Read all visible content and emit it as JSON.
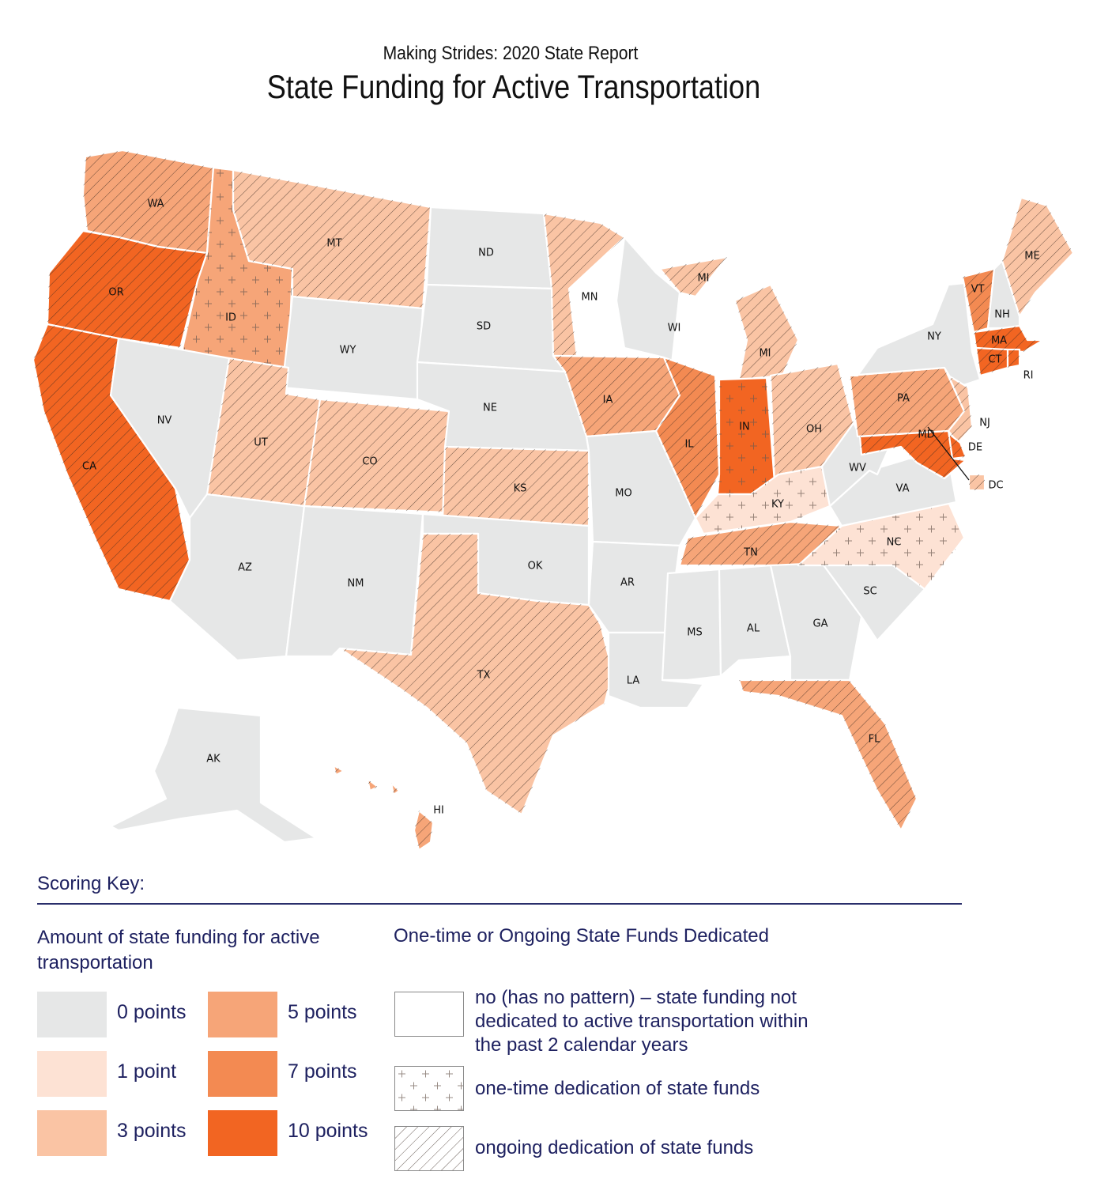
{
  "header": {
    "subtitle": "Making Strides:  2020 State Report",
    "title": "State Funding for Active Transportation"
  },
  "colors": {
    "score_0": "#E6E7E7",
    "score_1": "#FDE2D4",
    "score_3": "#FAC4A4",
    "score_5": "#F6A578",
    "score_7": "#F38A52",
    "score_10": "#F26522",
    "text_navy": "#1E2160",
    "border": "#FFFFFF"
  },
  "chart_data": {
    "type": "choropleth",
    "title": "State Funding for Active Transportation",
    "subtitle": "Making Strides:  2020 State Report",
    "states": [
      {
        "code": "WA",
        "score": 5,
        "pattern": "ongoing"
      },
      {
        "code": "OR",
        "score": 10,
        "pattern": "ongoing"
      },
      {
        "code": "CA",
        "score": 10,
        "pattern": "ongoing"
      },
      {
        "code": "ID",
        "score": 5,
        "pattern": "one-time"
      },
      {
        "code": "NV",
        "score": 0,
        "pattern": "none"
      },
      {
        "code": "MT",
        "score": 3,
        "pattern": "ongoing"
      },
      {
        "code": "WY",
        "score": 0,
        "pattern": "none"
      },
      {
        "code": "UT",
        "score": 3,
        "pattern": "ongoing"
      },
      {
        "code": "AZ",
        "score": 0,
        "pattern": "none"
      },
      {
        "code": "CO",
        "score": 3,
        "pattern": "ongoing"
      },
      {
        "code": "NM",
        "score": 0,
        "pattern": "none"
      },
      {
        "code": "ND",
        "score": 0,
        "pattern": "none"
      },
      {
        "code": "SD",
        "score": 0,
        "pattern": "none"
      },
      {
        "code": "NE",
        "score": 0,
        "pattern": "none"
      },
      {
        "code": "KS",
        "score": 3,
        "pattern": "ongoing"
      },
      {
        "code": "OK",
        "score": 0,
        "pattern": "none"
      },
      {
        "code": "TX",
        "score": 3,
        "pattern": "ongoing"
      },
      {
        "code": "MN",
        "score": 3,
        "pattern": "ongoing"
      },
      {
        "code": "IA",
        "score": 5,
        "pattern": "ongoing"
      },
      {
        "code": "MO",
        "score": 0,
        "pattern": "none"
      },
      {
        "code": "AR",
        "score": 0,
        "pattern": "none"
      },
      {
        "code": "LA",
        "score": 0,
        "pattern": "none"
      },
      {
        "code": "WI",
        "score": 0,
        "pattern": "none"
      },
      {
        "code": "IL",
        "score": 7,
        "pattern": "ongoing"
      },
      {
        "code": "MI",
        "score": 3,
        "pattern": "ongoing"
      },
      {
        "code": "IN",
        "score": 10,
        "pattern": "one-time"
      },
      {
        "code": "OH",
        "score": 3,
        "pattern": "ongoing"
      },
      {
        "code": "KY",
        "score": 1,
        "pattern": "one-time"
      },
      {
        "code": "TN",
        "score": 5,
        "pattern": "ongoing"
      },
      {
        "code": "MS",
        "score": 0,
        "pattern": "none"
      },
      {
        "code": "AL",
        "score": 0,
        "pattern": "none"
      },
      {
        "code": "GA",
        "score": 0,
        "pattern": "none"
      },
      {
        "code": "FL",
        "score": 5,
        "pattern": "ongoing"
      },
      {
        "code": "SC",
        "score": 0,
        "pattern": "none"
      },
      {
        "code": "NC",
        "score": 1,
        "pattern": "one-time"
      },
      {
        "code": "VA",
        "score": 0,
        "pattern": "none"
      },
      {
        "code": "WV",
        "score": 0,
        "pattern": "none"
      },
      {
        "code": "PA",
        "score": 5,
        "pattern": "ongoing"
      },
      {
        "code": "NY",
        "score": 0,
        "pattern": "none"
      },
      {
        "code": "NJ",
        "score": 3,
        "pattern": "ongoing"
      },
      {
        "code": "DE",
        "score": 10,
        "pattern": "ongoing"
      },
      {
        "code": "MD",
        "score": 10,
        "pattern": "ongoing"
      },
      {
        "code": "DC",
        "score": 3,
        "pattern": "ongoing"
      },
      {
        "code": "VT",
        "score": 7,
        "pattern": "ongoing"
      },
      {
        "code": "NH",
        "score": 0,
        "pattern": "none"
      },
      {
        "code": "ME",
        "score": 3,
        "pattern": "ongoing"
      },
      {
        "code": "MA",
        "score": 10,
        "pattern": "ongoing"
      },
      {
        "code": "CT",
        "score": 10,
        "pattern": "ongoing"
      },
      {
        "code": "RI",
        "score": 10,
        "pattern": "ongoing"
      },
      {
        "code": "AK",
        "score": 0,
        "pattern": "none"
      },
      {
        "code": "HI",
        "score": 5,
        "pattern": "ongoing"
      }
    ]
  },
  "legend": {
    "title": "Scoring Key:",
    "amount": {
      "title": "Amount of state funding for active transportation",
      "items": [
        {
          "label": "0 points",
          "score": 0
        },
        {
          "label": "1 point",
          "score": 1
        },
        {
          "label": "3 points",
          "score": 3
        },
        {
          "label": "5 points",
          "score": 5
        },
        {
          "label": "7 points",
          "score": 7
        },
        {
          "label": "10 points",
          "score": 10
        }
      ]
    },
    "dedication": {
      "title": "One-time or Ongoing State Funds Dedicated",
      "items": [
        {
          "label": "no (has no pattern) – state funding not dedicated to  active transportation within the past 2 calendar years",
          "pattern": "none"
        },
        {
          "label": "one-time dedication of state funds",
          "pattern": "one-time"
        },
        {
          "label": "ongoing dedication of state funds",
          "pattern": "ongoing"
        }
      ]
    }
  }
}
